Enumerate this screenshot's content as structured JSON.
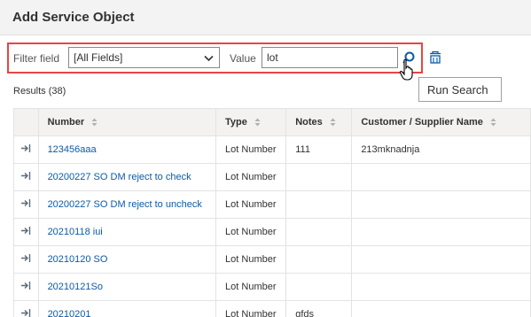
{
  "dialog": {
    "title": "Add Service Object"
  },
  "filter": {
    "field_label": "Filter field",
    "field_value": "[All Fields]",
    "value_label": "Value",
    "value_text": "lot"
  },
  "tooltip": "Run Search",
  "results_label": "Results (38)",
  "table": {
    "headers": [
      "Number",
      "Type",
      "Notes",
      "Customer / Supplier Name"
    ],
    "rows": [
      {
        "number": "123456aaa",
        "type": "Lot Number",
        "notes": "111",
        "customer": "213mknadnja"
      },
      {
        "number": "20200227 SO DM reject to check",
        "type": "Lot Number",
        "notes": "",
        "customer": ""
      },
      {
        "number": "20200227 SO DM reject to uncheck",
        "type": "Lot Number",
        "notes": "",
        "customer": ""
      },
      {
        "number": "20210118 iui",
        "type": "Lot Number",
        "notes": "",
        "customer": ""
      },
      {
        "number": "20210120 SO",
        "type": "Lot Number",
        "notes": "",
        "customer": ""
      },
      {
        "number": "20210121So",
        "type": "Lot Number",
        "notes": "",
        "customer": ""
      },
      {
        "number": "20210201",
        "type": "Lot Number",
        "notes": "gfds",
        "customer": ""
      }
    ]
  },
  "colors": {
    "accent": "#0a5aa8",
    "highlight_border": "#e64545"
  },
  "icons": {
    "select_row": "arrow-to-right-icon",
    "search": "search-icon",
    "clear": "clear-filter-icon",
    "sort": "sort-icon"
  }
}
